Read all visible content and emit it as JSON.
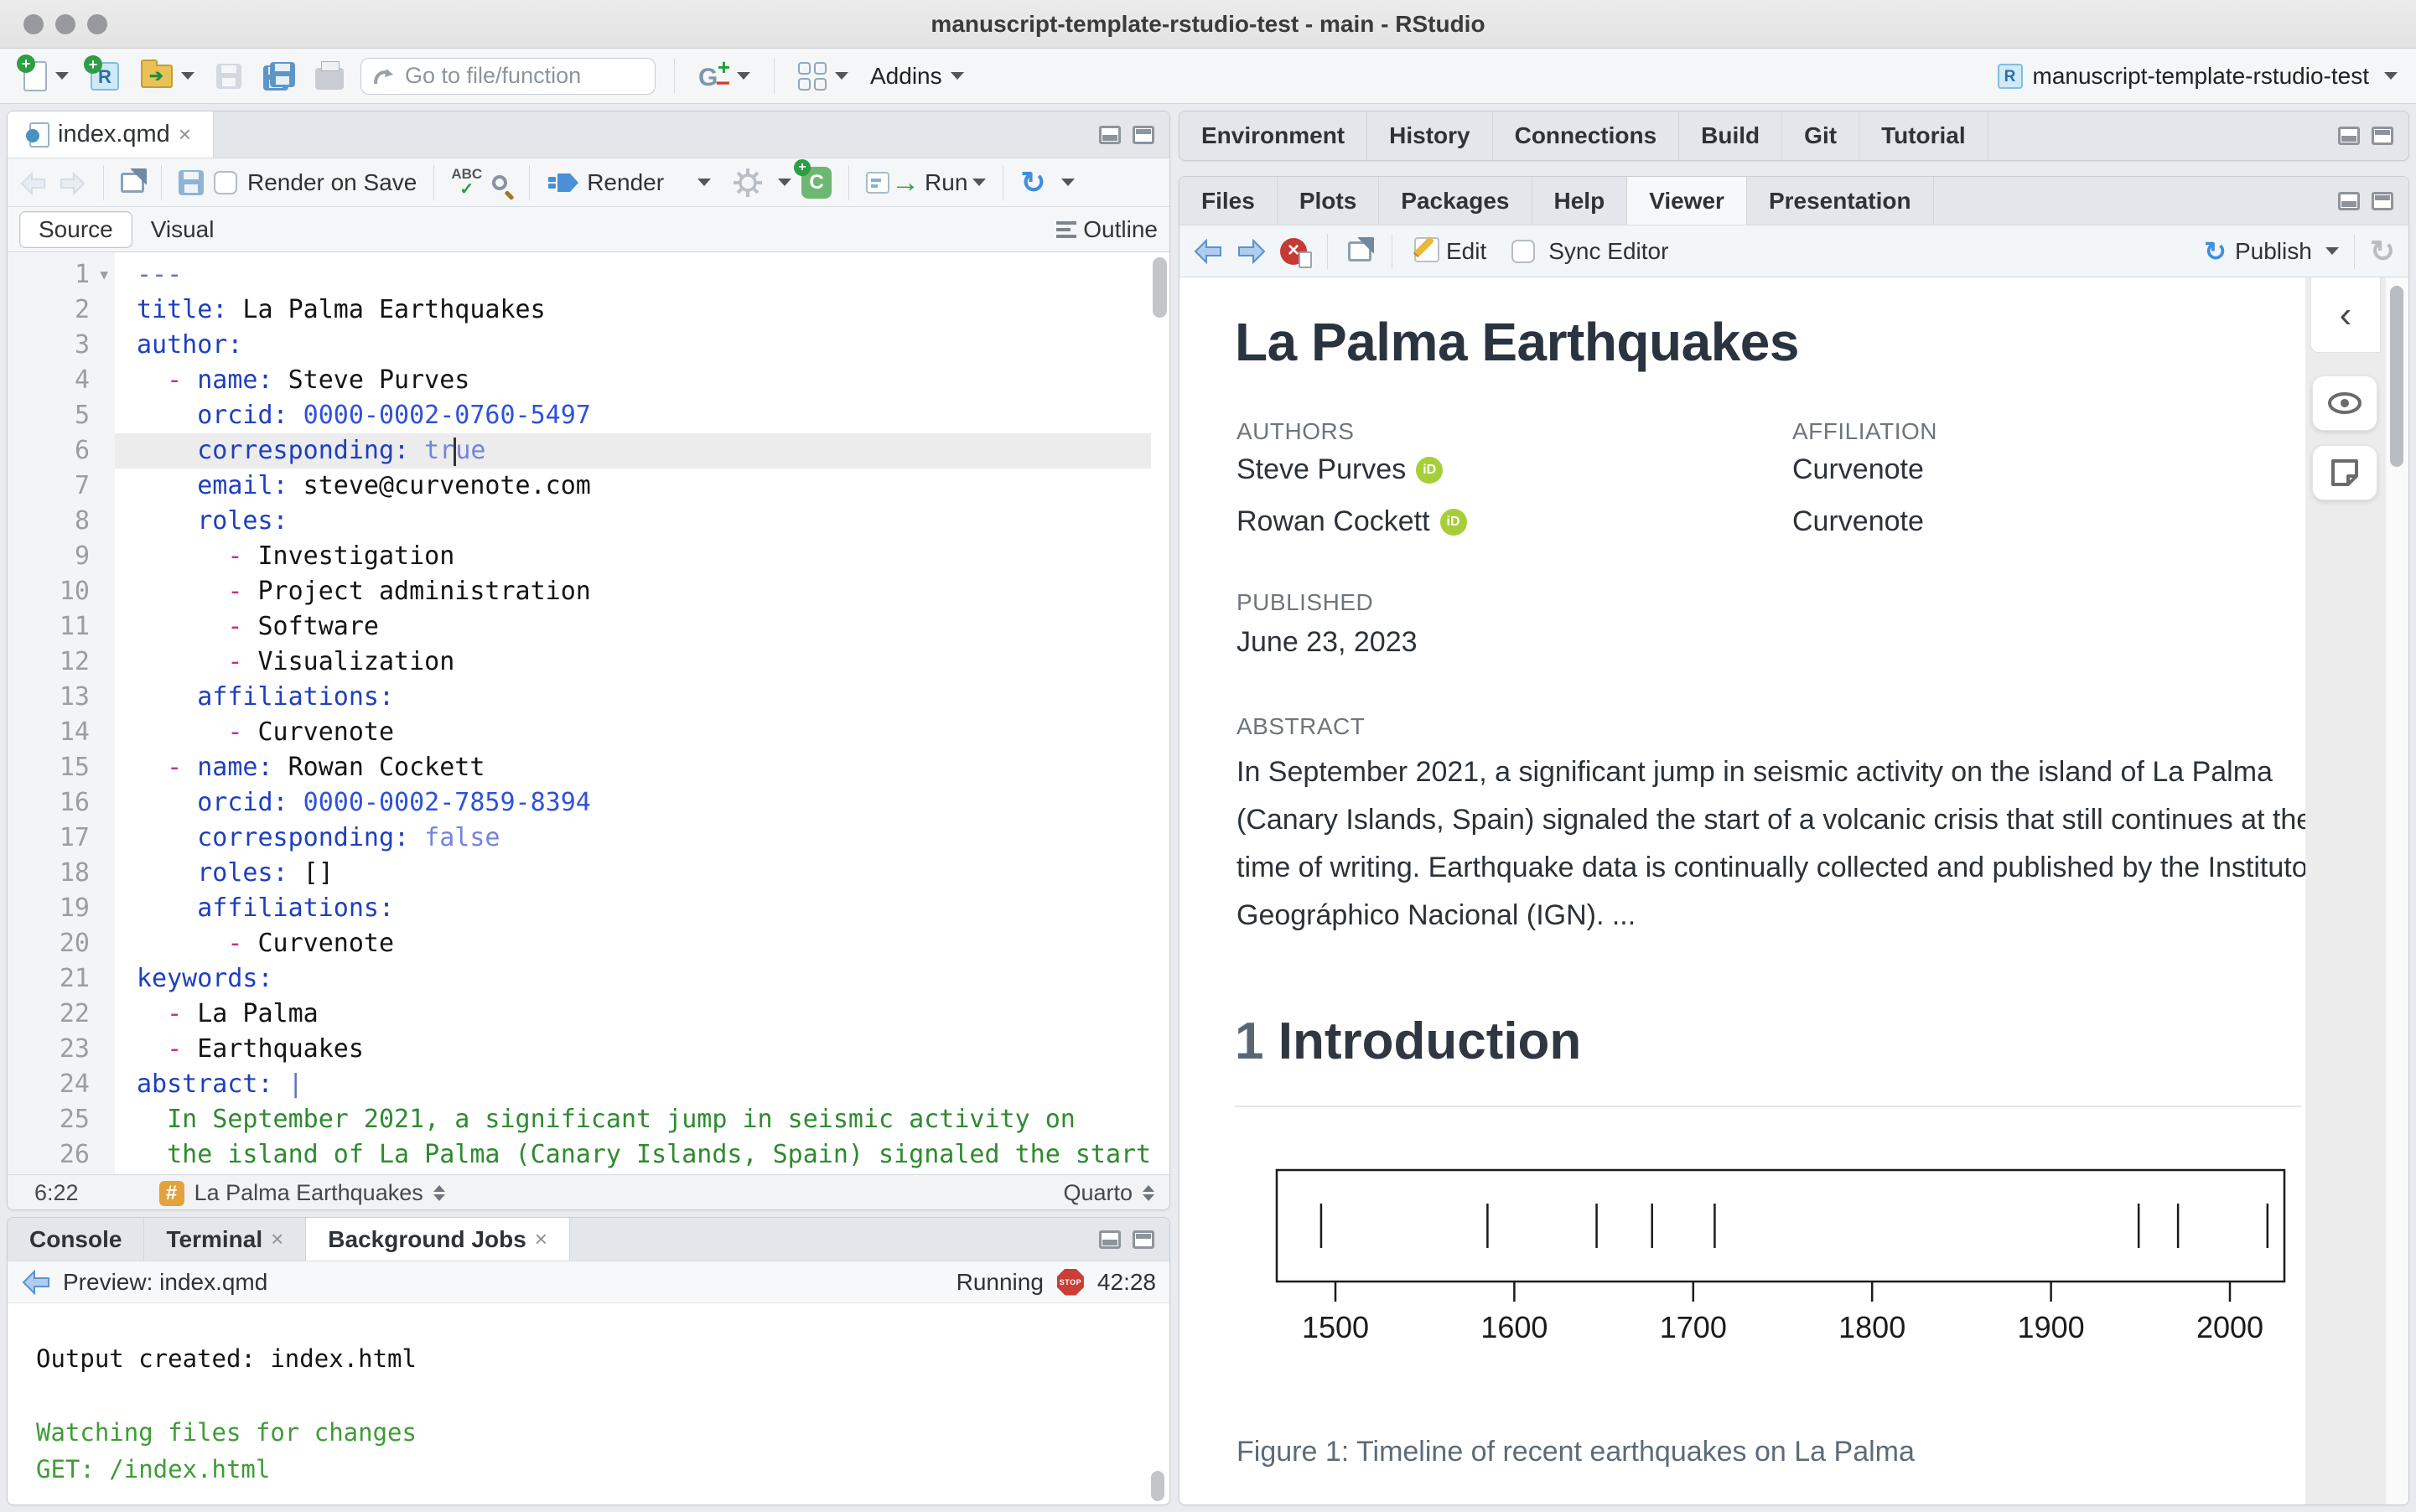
{
  "window": {
    "title": "manuscript-template-rstudio-test - main - RStudio"
  },
  "main_toolbar": {
    "goto_placeholder": "Go to file/function",
    "addins_label": "Addins",
    "project_label": "manuscript-template-rstudio-test"
  },
  "editor": {
    "tab": "index.qmd",
    "toolbar": {
      "render_on_save": "Render on Save",
      "render": "Render",
      "run": "Run"
    },
    "mode_tabs": {
      "source": "Source",
      "visual": "Visual",
      "outline": "Outline"
    },
    "status": {
      "cursor": "6:22",
      "section": "La Palma Earthquakes",
      "mode": "Quarto"
    },
    "lines": [
      {
        "n": 1,
        "fold": true,
        "seg": [
          [
            "m",
            "---"
          ]
        ]
      },
      {
        "n": 2,
        "seg": [
          [
            "k",
            "title:"
          ],
          [
            "t",
            " La Palma Earthquakes"
          ]
        ]
      },
      {
        "n": 3,
        "seg": [
          [
            "k",
            "author:"
          ]
        ]
      },
      {
        "n": 4,
        "seg": [
          [
            "t",
            "  "
          ],
          [
            "d",
            "- "
          ],
          [
            "k",
            "name:"
          ],
          [
            "t",
            " Steve Purves"
          ]
        ]
      },
      {
        "n": 5,
        "seg": [
          [
            "t",
            "    "
          ],
          [
            "k",
            "orcid:"
          ],
          [
            "v",
            " 0000-0002-0760-5497"
          ]
        ]
      },
      {
        "n": 6,
        "active": true,
        "seg": [
          [
            "t",
            "    "
          ],
          [
            "k",
            "corresponding:"
          ],
          [
            "b",
            " tr"
          ],
          [
            "c",
            ""
          ],
          [
            "b",
            "ue"
          ]
        ]
      },
      {
        "n": 7,
        "seg": [
          [
            "t",
            "    "
          ],
          [
            "k",
            "email:"
          ],
          [
            "t",
            " steve@curvenote.com"
          ]
        ]
      },
      {
        "n": 8,
        "seg": [
          [
            "t",
            "    "
          ],
          [
            "k",
            "roles:"
          ]
        ]
      },
      {
        "n": 9,
        "seg": [
          [
            "t",
            "      "
          ],
          [
            "d",
            "- "
          ],
          [
            "t",
            "Investigation"
          ]
        ]
      },
      {
        "n": 10,
        "seg": [
          [
            "t",
            "      "
          ],
          [
            "d",
            "- "
          ],
          [
            "t",
            "Project administration"
          ]
        ]
      },
      {
        "n": 11,
        "seg": [
          [
            "t",
            "      "
          ],
          [
            "d",
            "- "
          ],
          [
            "t",
            "Software"
          ]
        ]
      },
      {
        "n": 12,
        "seg": [
          [
            "t",
            "      "
          ],
          [
            "d",
            "- "
          ],
          [
            "t",
            "Visualization"
          ]
        ]
      },
      {
        "n": 13,
        "seg": [
          [
            "t",
            "    "
          ],
          [
            "k",
            "affiliations:"
          ]
        ]
      },
      {
        "n": 14,
        "seg": [
          [
            "t",
            "      "
          ],
          [
            "d",
            "- "
          ],
          [
            "t",
            "Curvenote"
          ]
        ]
      },
      {
        "n": 15,
        "seg": [
          [
            "t",
            "  "
          ],
          [
            "d",
            "- "
          ],
          [
            "k",
            "name:"
          ],
          [
            "t",
            " Rowan Cockett"
          ]
        ]
      },
      {
        "n": 16,
        "seg": [
          [
            "t",
            "    "
          ],
          [
            "k",
            "orcid:"
          ],
          [
            "v",
            " 0000-0002-7859-8394"
          ]
        ]
      },
      {
        "n": 17,
        "seg": [
          [
            "t",
            "    "
          ],
          [
            "k",
            "corresponding:"
          ],
          [
            "b",
            " false"
          ]
        ]
      },
      {
        "n": 18,
        "seg": [
          [
            "t",
            "    "
          ],
          [
            "k",
            "roles:"
          ],
          [
            "t",
            " []"
          ]
        ]
      },
      {
        "n": 19,
        "seg": [
          [
            "t",
            "    "
          ],
          [
            "k",
            "affiliations:"
          ]
        ]
      },
      {
        "n": 20,
        "seg": [
          [
            "t",
            "      "
          ],
          [
            "d",
            "- "
          ],
          [
            "t",
            "Curvenote"
          ]
        ]
      },
      {
        "n": 21,
        "seg": [
          [
            "k",
            "keywords:"
          ]
        ]
      },
      {
        "n": 22,
        "seg": [
          [
            "t",
            "  "
          ],
          [
            "d",
            "- "
          ],
          [
            "t",
            "La Palma"
          ]
        ]
      },
      {
        "n": 23,
        "seg": [
          [
            "t",
            "  "
          ],
          [
            "d",
            "- "
          ],
          [
            "t",
            "Earthquakes"
          ]
        ]
      },
      {
        "n": 24,
        "seg": [
          [
            "k",
            "abstract:"
          ],
          [
            "t",
            " "
          ],
          [
            "m",
            "|"
          ]
        ]
      },
      {
        "n": 25,
        "seg": [
          [
            "s",
            "  In September 2021, a significant jump in seismic activity on"
          ]
        ]
      },
      {
        "n": 26,
        "seg": [
          [
            "s",
            "  the island of La Palma (Canary Islands, Spain) signaled the start"
          ]
        ]
      }
    ]
  },
  "console": {
    "tabs": [
      {
        "label": "Console",
        "close": false,
        "active": false
      },
      {
        "label": "Terminal",
        "close": true,
        "active": false
      },
      {
        "label": "Background Jobs",
        "close": true,
        "active": true
      }
    ],
    "preview_label": "Preview: index.qmd",
    "running_label": "Running",
    "stop_label": "STOP",
    "elapsed": "42:28",
    "output": [
      {
        "style": "out",
        "text": "Output created: index.html"
      },
      {
        "style": "blank",
        "text": ""
      },
      {
        "style": "msg",
        "text": "Watching files for changes"
      },
      {
        "style": "msg",
        "text": "GET: /index.html"
      }
    ]
  },
  "right_top_tabs": [
    "Environment",
    "History",
    "Connections",
    "Build",
    "Git",
    "Tutorial"
  ],
  "right_mid_tabs": [
    {
      "label": "Files",
      "active": false
    },
    {
      "label": "Plots",
      "active": false
    },
    {
      "label": "Packages",
      "active": false
    },
    {
      "label": "Help",
      "active": false
    },
    {
      "label": "Viewer",
      "active": true
    },
    {
      "label": "Presentation",
      "active": false
    }
  ],
  "viewer_toolbar": {
    "edit": "Edit",
    "sync_editor": "Sync Editor",
    "publish": "Publish"
  },
  "article": {
    "title": "La Palma Earthquakes",
    "authors_label": "AUTHORS",
    "affiliation_label": "AFFILIATION",
    "authors": [
      {
        "name": "Steve Purves",
        "orcid_badge": "iD",
        "affiliation": "Curvenote"
      },
      {
        "name": "Rowan Cockett",
        "orcid_badge": "iD",
        "affiliation": "Curvenote"
      }
    ],
    "published_label": "PUBLISHED",
    "published": "June 23, 2023",
    "abstract_label": "ABSTRACT",
    "abstract": "In September 2021, a significant jump in seismic activity on the island of La Palma (Canary Islands, Spain) signaled the start of a volcanic crisis that still continues at the time of writing. Earthquake data is continually collected and published by the Instituto Geográphico Nacional (IGN). ...",
    "section_number": "1",
    "section_title": "Introduction",
    "figure_caption": "Figure 1: Timeline of recent earthquakes on La Palma"
  },
  "chart_data": {
    "type": "rug",
    "title": "",
    "xlabel": "",
    "ylabel": "",
    "x_ticks": [
      1500,
      1600,
      1700,
      1800,
      1900,
      2000
    ],
    "events": [
      1492,
      1585,
      1646,
      1677,
      1712,
      1949,
      1971,
      2021
    ],
    "xlim": [
      1467,
      2030
    ],
    "description": "Timeline rug plot of recent earthquakes on La Palma; one vertical tick per eruption year"
  },
  "colors": {
    "accent_blue": "#3e8ede",
    "run_green": "#27a043",
    "stop_red": "#cc3d36",
    "orcid_green": "#a6ce39",
    "yaml_key": "#1d3fc0",
    "yaml_bool": "#7584dd",
    "yaml_dash": "#c92d8c",
    "string_green": "#2e8b2e",
    "console_green": "#3f9c35",
    "hash_badge_orange": "#e3a23c"
  },
  "icons": {
    "traffic_lights": "three grey circles",
    "new_file": "document with green plus",
    "new_project": "blue cube with R",
    "open_folder": "yellow folder green arrow",
    "save": "grey floppy",
    "save_all": "blue floppies",
    "print": "printer",
    "goto": "curved grey arrow",
    "version_control": "G with green plus red minus",
    "pane_layout": "2x2 grid",
    "spellcheck": "ABC check",
    "search": "magnifier",
    "render": "blue arrow",
    "settings": "gear",
    "insert_chunk": "green C plus",
    "run": "code box green arrow",
    "rerun": "blue circular arrows",
    "back": "blue left arrow",
    "forward": "blue right arrow",
    "clear": "red circle x",
    "popout": "window with arrow",
    "edit": "pencil",
    "publish": "blue circular arrows",
    "refresh": "grey circular arrow",
    "collapse": "chevron left",
    "eye": "eye",
    "note": "sticky note",
    "section_hash": "#",
    "stop": "red octagon STOP"
  }
}
